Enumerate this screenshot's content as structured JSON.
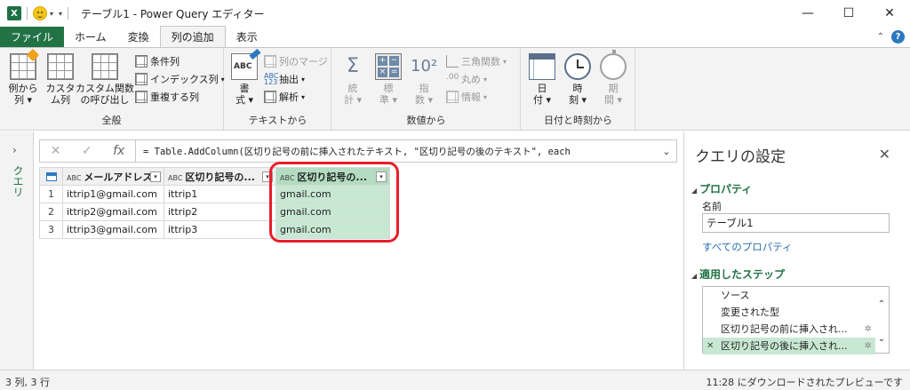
{
  "window": {
    "app_icon": "X",
    "title": "テーブル1 - Power Query エディター",
    "minimize": "—",
    "maximize": "☐",
    "close": "✕"
  },
  "tabs": [
    {
      "label": "ファイル"
    },
    {
      "label": "ホーム"
    },
    {
      "label": "変換"
    },
    {
      "label": "列の追加"
    },
    {
      "label": "表示"
    }
  ],
  "ribbon": {
    "general": {
      "label": "全般",
      "example_col": "例から\n列 ▾",
      "custom_col": "カスタ\nム列",
      "invoke_fn": "カスタム関数\nの呼び出し",
      "conditional": "条件列",
      "index": "インデックス列",
      "duplicate": "重複する列"
    },
    "text": {
      "label": "テキストから",
      "format": "書\n式 ▾",
      "merge": "列のマージ",
      "extract": "抽出",
      "parse": "解析"
    },
    "number": {
      "label": "数値から",
      "stats": "統\n計 ▾",
      "standard": "標\n準 ▾",
      "scientific": "指\n数 ▾",
      "trig": "三角関数",
      "rounding": "丸め",
      "info": "情報"
    },
    "datetime": {
      "label": "日付と時刻から",
      "date": "日\n付 ▾",
      "time": "時\n刻 ▾",
      "duration": "期\n間 ▾"
    }
  },
  "left_pane": {
    "label": "クエリ"
  },
  "formula_bar": {
    "cancel": "✕",
    "confirm": "✓",
    "fx": "fx",
    "text": "= Table.AddColumn(区切り記号の前に挿入されたテキスト, \"区切り記号の後のテキスト\", each"
  },
  "table": {
    "columns": [
      {
        "type": "ABC",
        "name": "メールアドレス"
      },
      {
        "type": "ABC",
        "name": "区切り記号の..."
      },
      {
        "type": "ABC",
        "name": "区切り記号の..."
      }
    ],
    "rows": [
      {
        "num": "1",
        "cells": [
          "ittrip1@gmail.com",
          "ittrip1",
          "gmail.com"
        ]
      },
      {
        "num": "2",
        "cells": [
          "ittrip2@gmail.com",
          "ittrip2",
          "gmail.com"
        ]
      },
      {
        "num": "3",
        "cells": [
          "ittrip3@gmail.com",
          "ittrip3",
          "gmail.com"
        ]
      }
    ]
  },
  "query_settings": {
    "title": "クエリの設定",
    "properties_header": "プロパティ",
    "name_label": "名前",
    "name_value": "テーブル1",
    "all_properties": "すべてのプロパティ",
    "steps_header": "適用したステップ",
    "steps": [
      "ソース",
      "変更された型",
      "区切り記号の前に挿入され...",
      "区切り記号の後に挿入され..."
    ]
  },
  "status": {
    "left": "3 列, 3 行",
    "right": "11:28 にダウンロードされたプレビューです"
  },
  "colors": {
    "excel_green": "#217346",
    "highlight": "#c8e8d3",
    "red_ring": "#e61e2a"
  }
}
